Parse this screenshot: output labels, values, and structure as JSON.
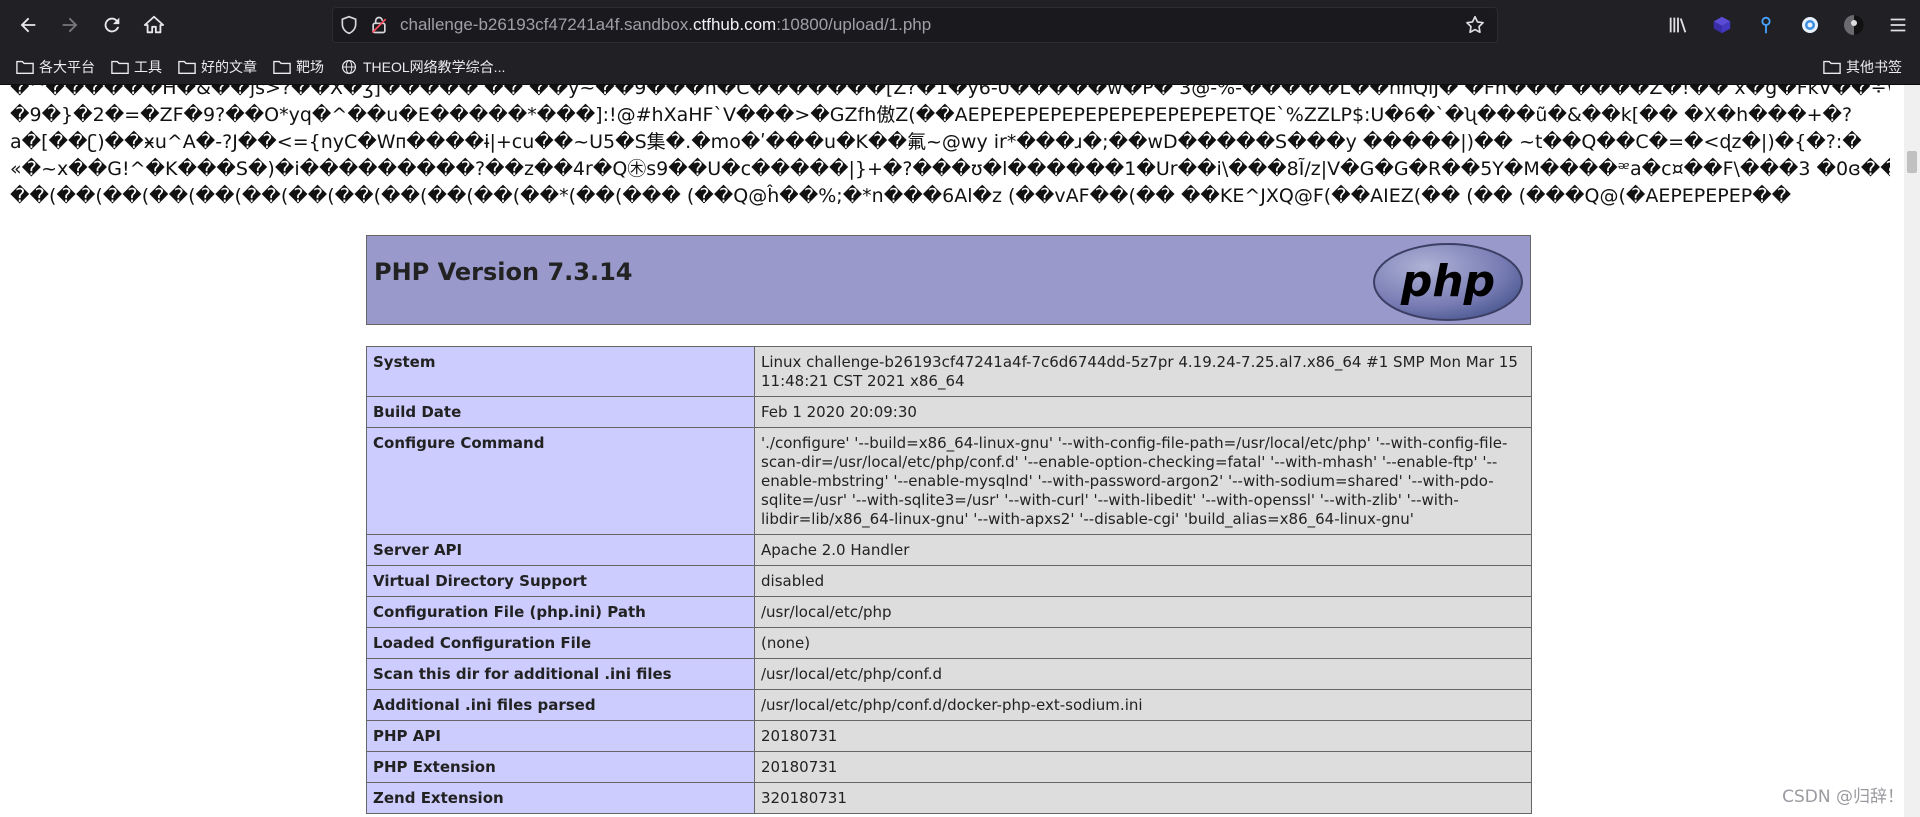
{
  "browser": {
    "url_prefix": "challenge-b26193cf47241a4f.sandbox.",
    "url_domain": "ctfhub.com",
    "url_suffix": ":10800/upload/1.php"
  },
  "bookmarks": {
    "items": [
      {
        "label": "各大平台",
        "icon": "folder-icon"
      },
      {
        "label": "工具",
        "icon": "folder-icon"
      },
      {
        "label": "好的文章",
        "icon": "folder-icon"
      },
      {
        "label": "靶场",
        "icon": "folder-icon"
      },
      {
        "label": "THEOL网络教学综合...",
        "icon": "globe-icon"
      }
    ],
    "other_label": "其他书签"
  },
  "garbage_lines": [
    " �^������H�&��js>?��X�ʒ]�����ʿ�� ��y~��9���h�C�������[Z?�1�y6-0�����w�P� 3@-%-�����L��hnQlJ� �Fh��� ����Z�!�� x�g�FkV��÷W}ˆ�",
    "�9�}�2�=�ZF�9?��O*yq�^��u�E�����*���]:!@#hXaHF`V���>�GZfh傲Z(��AEPEPEPEPEPEPEPEPEPEPEPETQE`%ZZLP$:U�6�`�ʯ���ũ�&��k[�� �X�h���+�?",
    "a�[��ʗ)��ӿu^A�-?J��<={nyC�Wᴨ����ɨ|+cu��~U5�S集�.�mo�ʹ���u�K��氟~@wy ir*���ɹ�;��wD�����S���y �����|)�� ~t��Q��C�=�<ɖz�|)�{�?:�",
    "«�~x��G!^�K���S�)�i���������?��z��4r�Q㊍s9��U�c�����|}+�?���ʊ�l������1�Ur��i\\���8Ĩ/z|V�G�G�R��5Y�M����ᵆa�c¤��F\\���3 �0ɞ��P",
    "��(��(��(��(��(��(��(��(��(��(��(��*(��(��� (��Q@ĥ��%;�*n���6Al�z (��vAF��(�� ��KE^JXQ@F(��AIEZ(�� (�� (���Q@(�AEPEPEPEP��"
  ],
  "php": {
    "header_title": "PHP Version 7.3.14",
    "logo_text": "php"
  },
  "info_rows": [
    {
      "key": "System",
      "value": "Linux challenge-b26193cf47241a4f-7c6d6744dd-5z7pr 4.19.24-7.25.al7.x86_64 #1 SMP Mon Mar 15 11:48:21 CST 2021 x86_64"
    },
    {
      "key": "Build Date",
      "value": "Feb 1 2020 20:09:30"
    },
    {
      "key": "Configure Command",
      "value": "'./configure' '--build=x86_64-linux-gnu' '--with-config-file-path=/usr/local/etc/php' '--with-config-file-scan-dir=/usr/local/etc/php/conf.d' '--enable-option-checking=fatal' '--with-mhash' '--enable-ftp' '--enable-mbstring' '--enable-mysqlnd' '--with-password-argon2' '--with-sodium=shared' '--with-pdo-sqlite=/usr' '--with-sqlite3=/usr' '--with-curl' '--with-libedit' '--with-openssl' '--with-zlib' '--with-libdir=lib/x86_64-linux-gnu' '--with-apxs2' '--disable-cgi' 'build_alias=x86_64-linux-gnu'"
    },
    {
      "key": "Server API",
      "value": "Apache 2.0 Handler"
    },
    {
      "key": "Virtual Directory Support",
      "value": "disabled"
    },
    {
      "key": "Configuration File (php.ini) Path",
      "value": "/usr/local/etc/php"
    },
    {
      "key": "Loaded Configuration File",
      "value": "(none)"
    },
    {
      "key": "Scan this dir for additional .ini files",
      "value": "/usr/local/etc/php/conf.d"
    },
    {
      "key": "Additional .ini files parsed",
      "value": "/usr/local/etc/php/conf.d/docker-php-ext-sodium.ini"
    },
    {
      "key": "PHP API",
      "value": "20180731"
    },
    {
      "key": "PHP Extension",
      "value": "20180731"
    },
    {
      "key": "Zend Extension",
      "value": "320180731"
    }
  ],
  "watermark": "CSDN @归辞！"
}
